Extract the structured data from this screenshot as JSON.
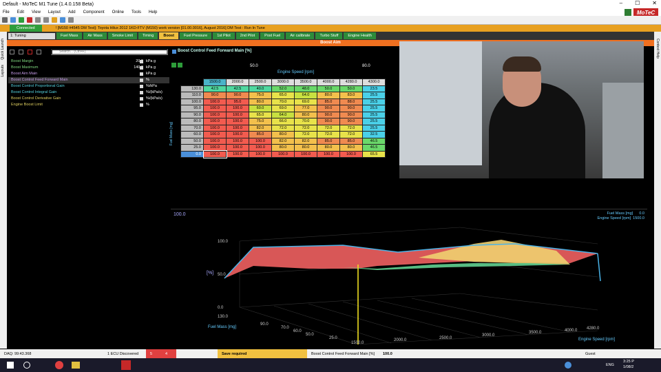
{
  "window": {
    "title": "Default - MoTeC M1 Tune (1.4.0.158 Beta)"
  },
  "menu": [
    "File",
    "Edit",
    "View",
    "Layout",
    "Add",
    "Component",
    "Online",
    "Tools",
    "Help"
  ],
  "brand": "MoTeC",
  "status": {
    "connected": "Connected",
    "info": "! [M150 #4545 DM Test]: Toyota Hilux 2012 1KD-FTV (M150) work version [01.00.0016], August 2016] DM Test : Run In Tune"
  },
  "workspace": {
    "selector": "1: Tuning",
    "tabs": [
      "Fuel Mass",
      "Air Mass",
      "Smoke Limit",
      "Timing",
      "Boost",
      "Fuel Pressure",
      "1st Pilot",
      "2nd Pilot",
      "Post Fuel",
      "Air calibrate",
      "Turbo Stuff",
      "Engine Health"
    ],
    "active_tab": "Boost"
  },
  "heading": "Boost Aim",
  "side_labels": {
    "left_a": "Quick Launch",
    "left_b": "Layouts",
    "right": "Context Help"
  },
  "search": {
    "placeholder": "Search... (Ctrl+F)"
  },
  "channels": [
    {
      "name": "Boost Margin",
      "value": "20.0",
      "unit": "kPa g",
      "color": "#7fd97f"
    },
    {
      "name": "Boost Maximum",
      "value": "140.0",
      "unit": "kPa g",
      "color": "#7fd97f"
    },
    {
      "name": "Boost Aim Main",
      "value": "",
      "unit": "kPa g",
      "color": "#c59be8"
    },
    {
      "name": "Boost Control Feed Forward Main",
      "value": "",
      "unit": "%",
      "color": "#c59be8"
    },
    {
      "name": "Boost Control Proportional Gain",
      "value": "",
      "unit": "%/kPa",
      "color": "#56d4e0"
    },
    {
      "name": "Boost Control Integral Gain",
      "value": "",
      "unit": "%/(kPa/s)",
      "color": "#56d4e0"
    },
    {
      "name": "Boost Control Derivative Gain",
      "value": "",
      "unit": "%/(kPa/s)",
      "color": "#e0d060"
    },
    {
      "name": "Engine Boost Limit",
      "value": "",
      "unit": "%",
      "color": "#e0d060"
    }
  ],
  "table": {
    "title": "Boost Control Feed Forward Main [%]",
    "x_value_left": "50.0",
    "x_value_right": "80.0",
    "x_axis": "Engine Speed [rpm]",
    "y_axis": "Fuel Mass [mg]",
    "columns": [
      "1500.0",
      "2000.0",
      "2500.0",
      "3000.0",
      "3500.0",
      "4000.0",
      "4280.0",
      "4300.0"
    ],
    "rows": [
      {
        "label": "130.0",
        "cells": [
          "42.5",
          "42.5",
          "40.0",
          "52.0",
          "48.0",
          "50.0",
          "50.0",
          "23.5"
        ]
      },
      {
        "label": "110.0",
        "cells": [
          "90.0",
          "90.0",
          "75.0",
          "65.0",
          "64.0",
          "80.0",
          "83.0",
          "25.5"
        ]
      },
      {
        "label": "100.0",
        "cells": [
          "100.0",
          "95.0",
          "80.0",
          "70.0",
          "69.0",
          "85.0",
          "88.0",
          "25.5"
        ]
      },
      {
        "label": "95.0",
        "cells": [
          "100.0",
          "100.0",
          "60.0",
          "69.0",
          "77.0",
          "90.0",
          "90.0",
          "25.5"
        ]
      },
      {
        "label": "90.0",
        "cells": [
          "100.0",
          "100.0",
          "65.0",
          "64.0",
          "80.0",
          "90.0",
          "90.0",
          "25.5"
        ]
      },
      {
        "label": "80.0",
        "cells": [
          "100.0",
          "100.0",
          "75.0",
          "66.0",
          "70.0",
          "90.0",
          "90.0",
          "25.5"
        ]
      },
      {
        "label": "70.0",
        "cells": [
          "100.0",
          "100.0",
          "82.0",
          "72.0",
          "72.0",
          "72.0",
          "72.0",
          "25.5"
        ]
      },
      {
        "label": "60.0",
        "cells": [
          "100.0",
          "100.0",
          "85.0",
          "80.0",
          "72.0",
          "72.0",
          "72.0",
          "32.5"
        ]
      },
      {
        "label": "50.0",
        "cells": [
          "100.0",
          "100.0",
          "100.0",
          "82.0",
          "82.0",
          "85.0",
          "85.0",
          "46.5"
        ]
      },
      {
        "label": "25.0",
        "cells": [
          "100.0",
          "100.0",
          "100.0",
          "80.0",
          "80.0",
          "80.0",
          "80.0",
          "46.5"
        ]
      },
      {
        "label": "0.0",
        "cells": [
          "100.0",
          "100.0",
          "100.0",
          "100.0",
          "100.0",
          "100.0",
          "100.0",
          "65.5"
        ]
      }
    ],
    "selected_column": "1500.0",
    "selected_row": "0.0"
  },
  "plot": {
    "value": "100.0",
    "legend_fuel_label": "Fuel Mass [mg]",
    "legend_fuel_value": "0.0",
    "legend_speed_label": "Engine Speed [rpm]",
    "legend_speed_value": "1500.0",
    "z_label": "[%]",
    "z_ticks": [
      "100.0",
      "50.0",
      "0.0"
    ],
    "fuel_ticks": [
      "130.0",
      "90.0",
      "70.0",
      "60.0",
      "50.0",
      "25.0"
    ],
    "speed_ticks": [
      "1500.0",
      "2000.0",
      "2500.0",
      "3000.0",
      "3500.0",
      "4000.0",
      "4280.0"
    ],
    "fuel_axis": "Fuel Mass [mg]",
    "speed_axis": "Engine Speed [rpm]"
  },
  "statusbar": {
    "daq": "DAQ: 99:43.368",
    "ecu": "1 ECU Discovered",
    "count_a": "5",
    "count_b": "4",
    "save": "Save required",
    "channel": "Boost Control Feed Forward Main [%]",
    "value": "100.0",
    "user": "Guest"
  },
  "tray": {
    "lang": "ENG",
    "time": "3:25 P",
    "date": "1/08/2"
  }
}
